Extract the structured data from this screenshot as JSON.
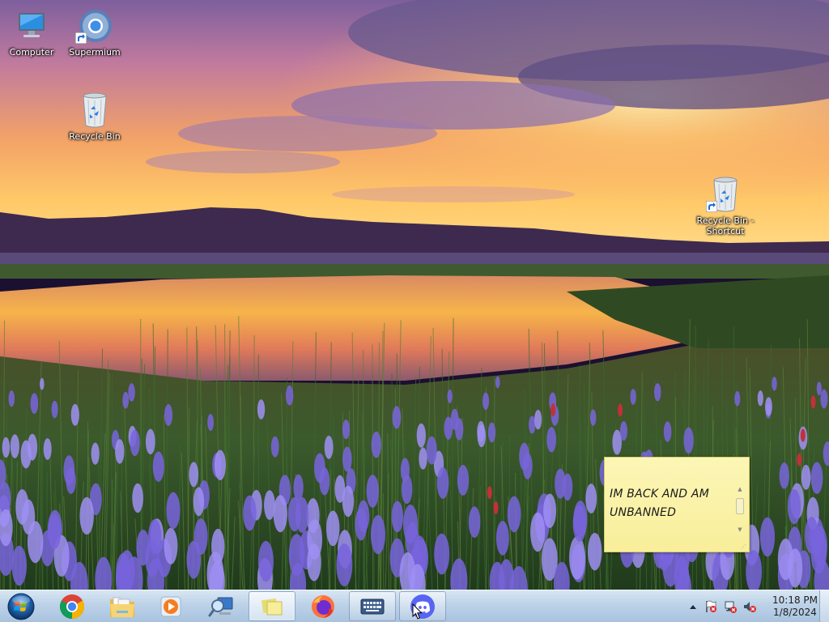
{
  "desktop": {
    "icons": [
      {
        "label": "Computer",
        "icon": "computer-icon"
      },
      {
        "label": "Supermium",
        "icon": "supermium-icon",
        "shortcut": true
      },
      {
        "label": "Recycle Bin",
        "icon": "recycle-bin-icon"
      },
      {
        "label": "Recycle Bin - Shortcut",
        "icon": "recycle-bin-icon",
        "shortcut": true
      }
    ]
  },
  "sticky_note": {
    "text": "IM BACK AND AM\nUNBANNED",
    "color": "#fcf3a8"
  },
  "taskbar": {
    "start_icon": "windows-start-orb-icon",
    "pinned": [
      {
        "name": "Google Chrome",
        "icon": "chrome-icon",
        "state": "pinned"
      },
      {
        "name": "Windows Explorer",
        "icon": "explorer-folder-icon",
        "state": "pinned"
      },
      {
        "name": "Windows Media Player",
        "icon": "media-player-icon",
        "state": "pinned"
      },
      {
        "name": "Magnifier",
        "icon": "magnifier-icon",
        "state": "pinned"
      },
      {
        "name": "Sticky Notes",
        "icon": "sticky-notes-icon",
        "state": "active"
      },
      {
        "name": "Firefox",
        "icon": "firefox-icon",
        "state": "pinned"
      },
      {
        "name": "On-Screen Keyboard",
        "icon": "keyboard-icon",
        "state": "open"
      },
      {
        "name": "Discord",
        "icon": "discord-icon",
        "state": "open"
      }
    ],
    "tray": {
      "icons": [
        "show-hidden-icons-chevron",
        "action-center-flag-error-icon",
        "network-error-icon",
        "volume-muted-icon"
      ],
      "time": "10:18 PM",
      "date": "1/8/2024"
    }
  },
  "colors": {
    "taskbar_top": "#d8e6f3",
    "taskbar_bottom": "#a9c3de",
    "discord": "#5865f2",
    "sticky": "#fcf3a8"
  }
}
